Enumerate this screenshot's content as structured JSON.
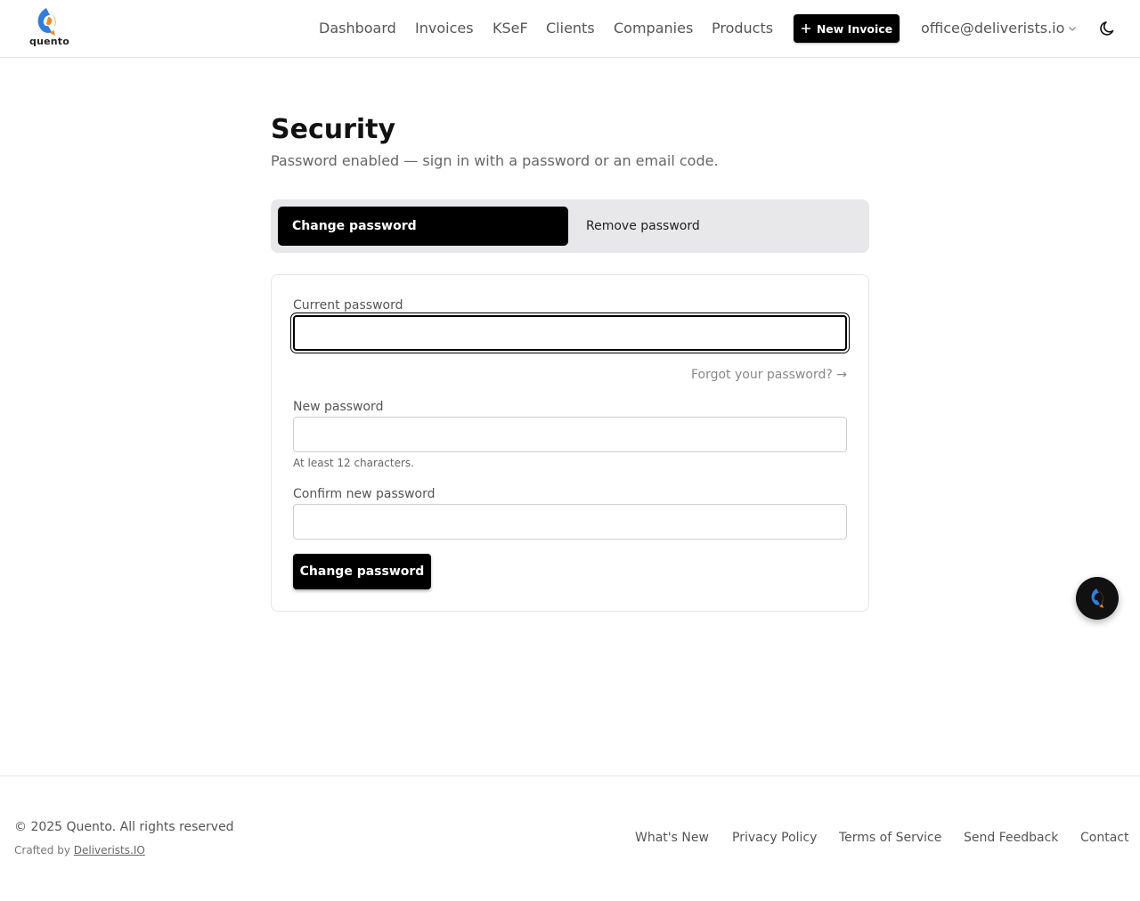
{
  "header": {
    "logo_text": "quento",
    "nav": [
      {
        "label": "Dashboard"
      },
      {
        "label": "Invoices"
      },
      {
        "label": "KSeF"
      },
      {
        "label": "Clients"
      },
      {
        "label": "Companies"
      },
      {
        "label": "Products"
      }
    ],
    "new_invoice_label": "New Invoice",
    "account_email": "office@deliverists.io",
    "icons": {
      "plus": "plus-icon",
      "chevron": "chevron-down-icon",
      "theme": "moon-icon"
    }
  },
  "page": {
    "title": "Security",
    "subtitle": "Password enabled — sign in with a password or an email code."
  },
  "tabs": {
    "active": "Change password",
    "inactive": "Remove password"
  },
  "form": {
    "current_label": "Current password",
    "current_value": "",
    "forgot_label": "Forgot your password? →",
    "new_label": "New password",
    "new_value": "",
    "new_hint": "At least 12 characters.",
    "confirm_label": "Confirm new password",
    "confirm_value": "",
    "submit_label": "Change password"
  },
  "footer": {
    "copyright": "© 2025 Quento. All rights reserved",
    "crafted_prefix": "Crafted by",
    "crafted_link": "Deliverists.IO",
    "links": [
      {
        "label": "What's New"
      },
      {
        "label": "Privacy Policy"
      },
      {
        "label": "Terms of Service"
      },
      {
        "label": "Send Feedback"
      },
      {
        "label": "Contact"
      }
    ]
  },
  "colors": {
    "accent": "#000000",
    "logo_blue": "#2f7de1",
    "logo_orange": "#f28c1e",
    "tabs_bg": "#e8e8ea"
  }
}
